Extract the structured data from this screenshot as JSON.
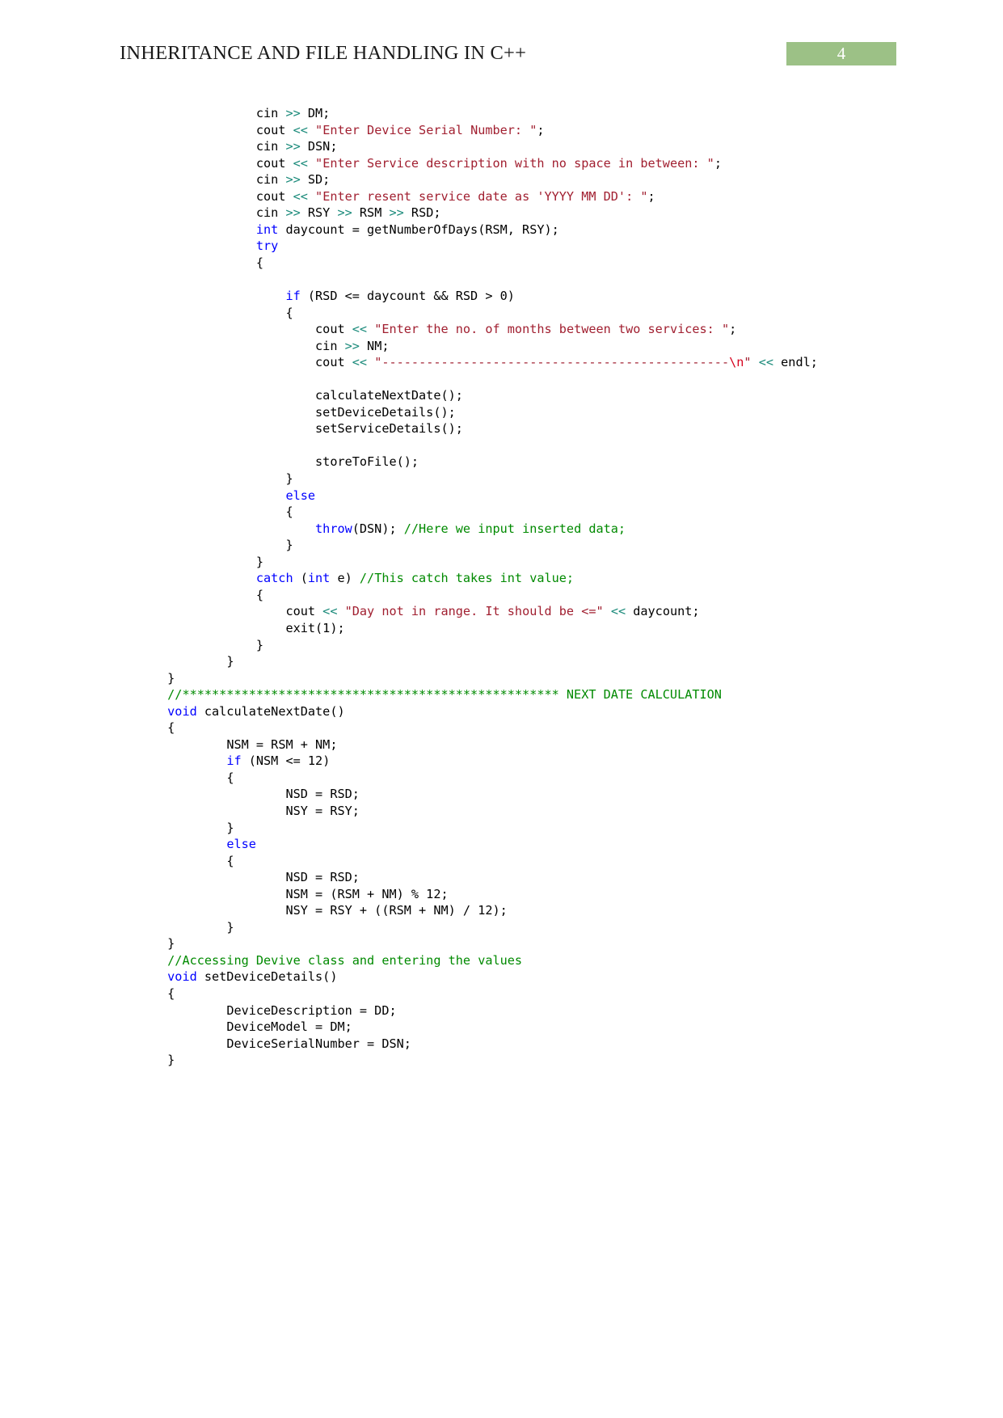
{
  "document": {
    "header": {
      "title": "INHERITANCE AND FILE HANDLING IN C++",
      "page_number": "4",
      "badge_color": "#9cc186",
      "badge_text_color": "#ffffff"
    },
    "syntax_colors": {
      "keyword": "#0000ff",
      "string": "#a11f30",
      "escape": "#d6001c",
      "operator": "#1a8a7a",
      "comment": "#008a00",
      "plain": "#000000"
    },
    "code_listing": {
      "language": "C++",
      "lines": [
        "                    cin >> DM;",
        "                    cout << \"Enter Device Serial Number: \";",
        "                    cin >> DSN;",
        "                    cout << \"Enter Service description with no space in between: \";",
        "                    cin >> SD;",
        "                    cout << \"Enter resent service date as 'YYYY MM DD': \";",
        "                    cin >> RSY >> RSM >> RSD;",
        "                    int daycount = getNumberOfDays(RSM, RSY);",
        "                    try",
        "                    {",
        "",
        "                        if (RSD <= daycount && RSD > 0)",
        "                        {",
        "                            cout << \"Enter the no. of months between two services: \";",
        "                            cin >> NM;",
        "                            cout << \"-----------------------------------------------\\n\" << endl;",
        "",
        "                            calculateNextDate();",
        "                            setDeviceDetails();",
        "                            setServiceDetails();",
        "",
        "                            storeToFile();",
        "                        }",
        "                        else",
        "                        {",
        "                            throw(DSN); //Here we input inserted data;",
        "                        }",
        "                    }",
        "                    catch (int e) //This catch takes int value;",
        "                    {",
        "                        cout << \"Day not in range. It should be <=\" << daycount;",
        "                        exit(1);",
        "                    }",
        "                }",
        "        }",
        "        //*************************************************** NEXT DATE CALCULATION",
        "        void calculateNextDate()",
        "        {",
        "                NSM = RSM + NM;",
        "                if (NSM <= 12)",
        "                {",
        "                        NSD = RSD;",
        "                        NSY = RSY;",
        "                }",
        "                else",
        "                {",
        "                        NSD = RSD;",
        "                        NSM = (RSM + NM) % 12;",
        "                        NSY = RSY + ((RSM + NM) / 12);",
        "                }",
        "        }",
        "        //Accessing Devive class and entering the values",
        "        void setDeviceDetails()",
        "        {",
        "                DeviceDescription = DD;",
        "                DeviceModel = DM;",
        "                DeviceSerialNumber = DSN;",
        "        }"
      ],
      "tokens": [
        {
          "segments": [
            {
              "t": "                    cin ",
              "c": "pl"
            },
            {
              "t": ">>",
              "c": "op"
            },
            {
              "t": " DM;",
              "c": "pl"
            }
          ]
        },
        {
          "segments": [
            {
              "t": "                    cout ",
              "c": "pl"
            },
            {
              "t": "<<",
              "c": "op"
            },
            {
              "t": " ",
              "c": "pl"
            },
            {
              "t": "\"Enter Device Serial Number: \"",
              "c": "str"
            },
            {
              "t": ";",
              "c": "pl"
            }
          ]
        },
        {
          "segments": [
            {
              "t": "                    cin ",
              "c": "pl"
            },
            {
              "t": ">>",
              "c": "op"
            },
            {
              "t": " DSN;",
              "c": "pl"
            }
          ]
        },
        {
          "segments": [
            {
              "t": "                    cout ",
              "c": "pl"
            },
            {
              "t": "<<",
              "c": "op"
            },
            {
              "t": " ",
              "c": "pl"
            },
            {
              "t": "\"Enter Service description with no space in between: \"",
              "c": "str"
            },
            {
              "t": ";",
              "c": "pl"
            }
          ]
        },
        {
          "segments": [
            {
              "t": "                    cin ",
              "c": "pl"
            },
            {
              "t": ">>",
              "c": "op"
            },
            {
              "t": " SD;",
              "c": "pl"
            }
          ]
        },
        {
          "segments": [
            {
              "t": "                    cout ",
              "c": "pl"
            },
            {
              "t": "<<",
              "c": "op"
            },
            {
              "t": " ",
              "c": "pl"
            },
            {
              "t": "\"Enter resent service date as 'YYYY MM DD': \"",
              "c": "str"
            },
            {
              "t": ";",
              "c": "pl"
            }
          ]
        },
        {
          "segments": [
            {
              "t": "                    cin ",
              "c": "pl"
            },
            {
              "t": ">>",
              "c": "op"
            },
            {
              "t": " RSY ",
              "c": "pl"
            },
            {
              "t": ">>",
              "c": "op"
            },
            {
              "t": " RSM ",
              "c": "pl"
            },
            {
              "t": ">>",
              "c": "op"
            },
            {
              "t": " RSD;",
              "c": "pl"
            }
          ]
        },
        {
          "segments": [
            {
              "t": "                    ",
              "c": "pl"
            },
            {
              "t": "int",
              "c": "kw"
            },
            {
              "t": " daycount = getNumberOfDays(RSM, RSY);",
              "c": "pl"
            }
          ]
        },
        {
          "segments": [
            {
              "t": "                    ",
              "c": "pl"
            },
            {
              "t": "try",
              "c": "kw"
            }
          ]
        },
        {
          "segments": [
            {
              "t": "                    {",
              "c": "pl"
            }
          ]
        },
        {
          "segments": [
            {
              "t": "",
              "c": "pl"
            }
          ]
        },
        {
          "segments": [
            {
              "t": "                        ",
              "c": "pl"
            },
            {
              "t": "if",
              "c": "kw"
            },
            {
              "t": " (RSD <= daycount && RSD > 0)",
              "c": "pl"
            }
          ]
        },
        {
          "segments": [
            {
              "t": "                        {",
              "c": "pl"
            }
          ]
        },
        {
          "segments": [
            {
              "t": "                            cout ",
              "c": "pl"
            },
            {
              "t": "<<",
              "c": "op"
            },
            {
              "t": " ",
              "c": "pl"
            },
            {
              "t": "\"Enter the no. of months between two services: \"",
              "c": "str"
            },
            {
              "t": ";",
              "c": "pl"
            }
          ]
        },
        {
          "segments": [
            {
              "t": "                            cin ",
              "c": "pl"
            },
            {
              "t": ">>",
              "c": "op"
            },
            {
              "t": " NM;",
              "c": "pl"
            }
          ]
        },
        {
          "segments": [
            {
              "t": "                            cout ",
              "c": "pl"
            },
            {
              "t": "<<",
              "c": "op"
            },
            {
              "t": " ",
              "c": "pl"
            },
            {
              "t": "\"-----------------------------------------------",
              "c": "str"
            },
            {
              "t": "\\n",
              "c": "esc"
            },
            {
              "t": "\"",
              "c": "str"
            },
            {
              "t": " ",
              "c": "pl"
            },
            {
              "t": "<<",
              "c": "op"
            },
            {
              "t": " endl;",
              "c": "pl"
            }
          ]
        },
        {
          "segments": [
            {
              "t": "",
              "c": "pl"
            }
          ]
        },
        {
          "segments": [
            {
              "t": "                            calculateNextDate();",
              "c": "pl"
            }
          ]
        },
        {
          "segments": [
            {
              "t": "                            setDeviceDetails();",
              "c": "pl"
            }
          ]
        },
        {
          "segments": [
            {
              "t": "                            setServiceDetails();",
              "c": "pl"
            }
          ]
        },
        {
          "segments": [
            {
              "t": "",
              "c": "pl"
            }
          ]
        },
        {
          "segments": [
            {
              "t": "                            storeToFile();",
              "c": "pl"
            }
          ]
        },
        {
          "segments": [
            {
              "t": "                        }",
              "c": "pl"
            }
          ]
        },
        {
          "segments": [
            {
              "t": "                        ",
              "c": "pl"
            },
            {
              "t": "else",
              "c": "kw"
            }
          ]
        },
        {
          "segments": [
            {
              "t": "                        {",
              "c": "pl"
            }
          ]
        },
        {
          "segments": [
            {
              "t": "                            ",
              "c": "pl"
            },
            {
              "t": "throw",
              "c": "kw"
            },
            {
              "t": "(DSN); ",
              "c": "pl"
            },
            {
              "t": "//Here we input inserted data;",
              "c": "cmt"
            }
          ]
        },
        {
          "segments": [
            {
              "t": "                        }",
              "c": "pl"
            }
          ]
        },
        {
          "segments": [
            {
              "t": "                    }",
              "c": "pl"
            }
          ]
        },
        {
          "segments": [
            {
              "t": "                    ",
              "c": "pl"
            },
            {
              "t": "catch",
              "c": "kw"
            },
            {
              "t": " (",
              "c": "pl"
            },
            {
              "t": "int",
              "c": "kw"
            },
            {
              "t": " e) ",
              "c": "pl"
            },
            {
              "t": "//This catch takes int value;",
              "c": "cmt"
            }
          ]
        },
        {
          "segments": [
            {
              "t": "                    {",
              "c": "pl"
            }
          ]
        },
        {
          "segments": [
            {
              "t": "                        cout ",
              "c": "pl"
            },
            {
              "t": "<<",
              "c": "op"
            },
            {
              "t": " ",
              "c": "pl"
            },
            {
              "t": "\"Day not in range. It should be <=\"",
              "c": "str"
            },
            {
              "t": " ",
              "c": "pl"
            },
            {
              "t": "<<",
              "c": "op"
            },
            {
              "t": " daycount;",
              "c": "pl"
            }
          ]
        },
        {
          "segments": [
            {
              "t": "                        exit(1);",
              "c": "pl"
            }
          ]
        },
        {
          "segments": [
            {
              "t": "                    }",
              "c": "pl"
            }
          ]
        },
        {
          "segments": [
            {
              "t": "                }",
              "c": "pl"
            }
          ]
        },
        {
          "segments": [
            {
              "t": "        }",
              "c": "pl"
            }
          ]
        },
        {
          "segments": [
            {
              "t": "        ",
              "c": "pl"
            },
            {
              "t": "//*************************************************** NEXT DATE CALCULATION",
              "c": "cmt"
            }
          ]
        },
        {
          "segments": [
            {
              "t": "        ",
              "c": "pl"
            },
            {
              "t": "void",
              "c": "kw"
            },
            {
              "t": " calculateNextDate()",
              "c": "pl"
            }
          ]
        },
        {
          "segments": [
            {
              "t": "        {",
              "c": "pl"
            }
          ]
        },
        {
          "segments": [
            {
              "t": "                NSM = RSM + NM;",
              "c": "pl"
            }
          ]
        },
        {
          "segments": [
            {
              "t": "                ",
              "c": "pl"
            },
            {
              "t": "if",
              "c": "kw"
            },
            {
              "t": " (NSM <= 12)",
              "c": "pl"
            }
          ]
        },
        {
          "segments": [
            {
              "t": "                {",
              "c": "pl"
            }
          ]
        },
        {
          "segments": [
            {
              "t": "                        NSD = RSD;",
              "c": "pl"
            }
          ]
        },
        {
          "segments": [
            {
              "t": "                        NSY = RSY;",
              "c": "pl"
            }
          ]
        },
        {
          "segments": [
            {
              "t": "                }",
              "c": "pl"
            }
          ]
        },
        {
          "segments": [
            {
              "t": "                ",
              "c": "pl"
            },
            {
              "t": "else",
              "c": "kw"
            }
          ]
        },
        {
          "segments": [
            {
              "t": "                {",
              "c": "pl"
            }
          ]
        },
        {
          "segments": [
            {
              "t": "                        NSD = RSD;",
              "c": "pl"
            }
          ]
        },
        {
          "segments": [
            {
              "t": "                        NSM = (RSM + NM) % 12;",
              "c": "pl"
            }
          ]
        },
        {
          "segments": [
            {
              "t": "                        NSY = RSY + ((RSM + NM) / 12);",
              "c": "pl"
            }
          ]
        },
        {
          "segments": [
            {
              "t": "                }",
              "c": "pl"
            }
          ]
        },
        {
          "segments": [
            {
              "t": "        }",
              "c": "pl"
            }
          ]
        },
        {
          "segments": [
            {
              "t": "        ",
              "c": "pl"
            },
            {
              "t": "//Accessing Devive class and entering the values",
              "c": "cmt"
            }
          ]
        },
        {
          "segments": [
            {
              "t": "        ",
              "c": "pl"
            },
            {
              "t": "void",
              "c": "kw"
            },
            {
              "t": " setDeviceDetails()",
              "c": "pl"
            }
          ]
        },
        {
          "segments": [
            {
              "t": "        {",
              "c": "pl"
            }
          ]
        },
        {
          "segments": [
            {
              "t": "                DeviceDescription = DD;",
              "c": "pl"
            }
          ]
        },
        {
          "segments": [
            {
              "t": "                DeviceModel = DM;",
              "c": "pl"
            }
          ]
        },
        {
          "segments": [
            {
              "t": "                DeviceSerialNumber = DSN;",
              "c": "pl"
            }
          ]
        },
        {
          "segments": [
            {
              "t": "        }",
              "c": "pl"
            }
          ]
        }
      ]
    }
  }
}
